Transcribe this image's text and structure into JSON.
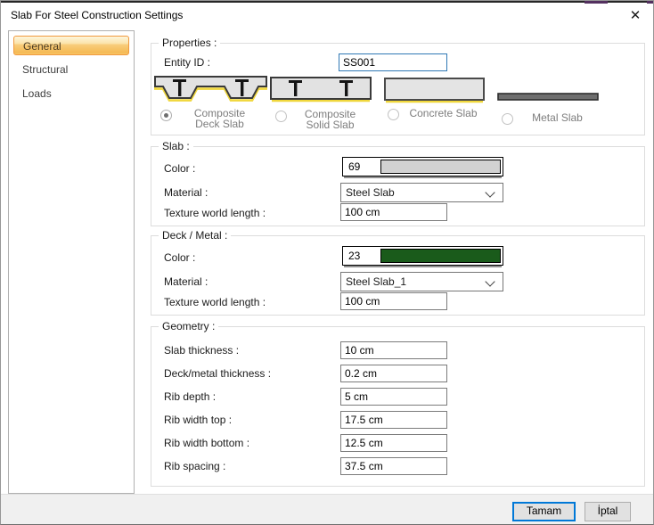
{
  "window": {
    "title": "Slab For Steel Construction Settings",
    "close_icon": "✕"
  },
  "sidebar": {
    "items": [
      {
        "label": "General",
        "selected": true
      },
      {
        "label": "Structural",
        "selected": false
      },
      {
        "label": "Loads",
        "selected": false
      }
    ]
  },
  "properties": {
    "legend": "Properties :",
    "entity_id_label": "Entity ID :",
    "entity_id_value": "SS001",
    "slab_types": [
      {
        "label_line1": "Composite",
        "label_line2": "Deck Slab",
        "selected": true
      },
      {
        "label_line1": "Composite",
        "label_line2": "Solid Slab",
        "selected": false
      },
      {
        "label_line1": "Concrete Slab",
        "label_line2": "",
        "selected": false
      },
      {
        "label_line1": "Metal Slab",
        "label_line2": "",
        "selected": false
      }
    ]
  },
  "slab": {
    "legend": "Slab :",
    "color_label": "Color :",
    "color_number": "69",
    "color_hex": "#d2d2d2",
    "material_label": "Material :",
    "material_value": "Steel Slab",
    "texture_label": "Texture world length :",
    "texture_value": "100 cm"
  },
  "deck_metal": {
    "legend": "Deck / Metal :",
    "color_label": "Color :",
    "color_number": "23",
    "color_hex": "#1a5b1b",
    "material_label": "Material :",
    "material_value": "Steel Slab_1",
    "texture_label": "Texture world length :",
    "texture_value": "100 cm"
  },
  "geometry": {
    "legend": "Geometry :",
    "rows": [
      {
        "label": "Slab thickness :",
        "value": "10 cm"
      },
      {
        "label": "Deck/metal thickness :",
        "value": "0.2 cm"
      },
      {
        "label": "Rib depth :",
        "value": "5 cm"
      },
      {
        "label": "Rib width top :",
        "value": "17.5 cm"
      },
      {
        "label": "Rib width bottom :",
        "value": "12.5 cm"
      },
      {
        "label": "Rib spacing :",
        "value": "37.5 cm"
      }
    ]
  },
  "footer": {
    "ok_label": "Tamam",
    "cancel_label": "İptal"
  }
}
